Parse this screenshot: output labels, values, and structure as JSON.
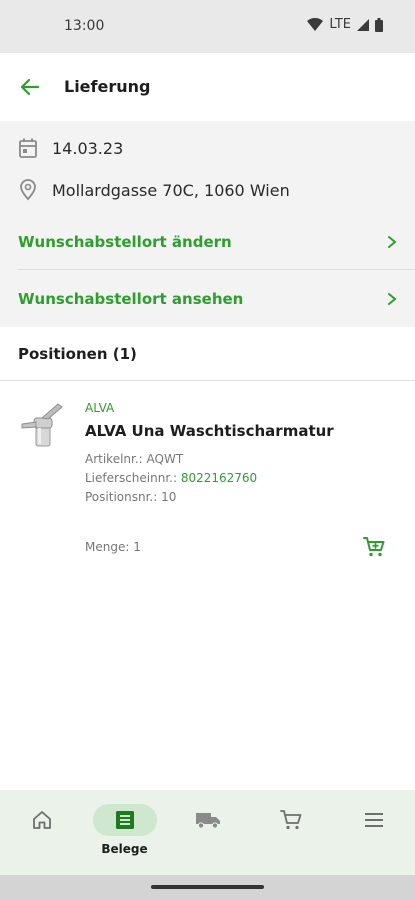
{
  "status_bar": {
    "time": "13:00",
    "network": "LTE"
  },
  "app_bar": {
    "title": "Lieferung"
  },
  "delivery_info": {
    "date": "14.03.23",
    "address": "Mollardgasse 70C, 1060 Wien",
    "links": [
      {
        "label": "Wunschabstellort ändern"
      },
      {
        "label": "Wunschabstellort ansehen"
      }
    ]
  },
  "positions": {
    "title": "Positionen (1)",
    "items": [
      {
        "brand": "ALVA",
        "name": "ALVA Una Waschtischarmatur",
        "article_label": "Artikelnr.:",
        "article_value": "AQWT",
        "delivery_note_label": "Lieferscheinnr.:",
        "delivery_note_value": "8022162760",
        "position_label": "Positionsnr.:",
        "position_value": "10",
        "quantity": "Menge: 1"
      }
    ]
  },
  "bottom_nav": {
    "items": [
      {
        "icon": "home-icon",
        "label": ""
      },
      {
        "icon": "receipt-icon",
        "label": "Belege",
        "active": true
      },
      {
        "icon": "truck-icon",
        "label": ""
      },
      {
        "icon": "cart-icon",
        "label": ""
      },
      {
        "icon": "menu-icon",
        "label": ""
      }
    ]
  },
  "colors": {
    "accent": "#2e9e2e",
    "nav_bg": "#eaf2ea",
    "active_pill": "#cfe6cf",
    "info_bg": "#f3f3f3"
  }
}
